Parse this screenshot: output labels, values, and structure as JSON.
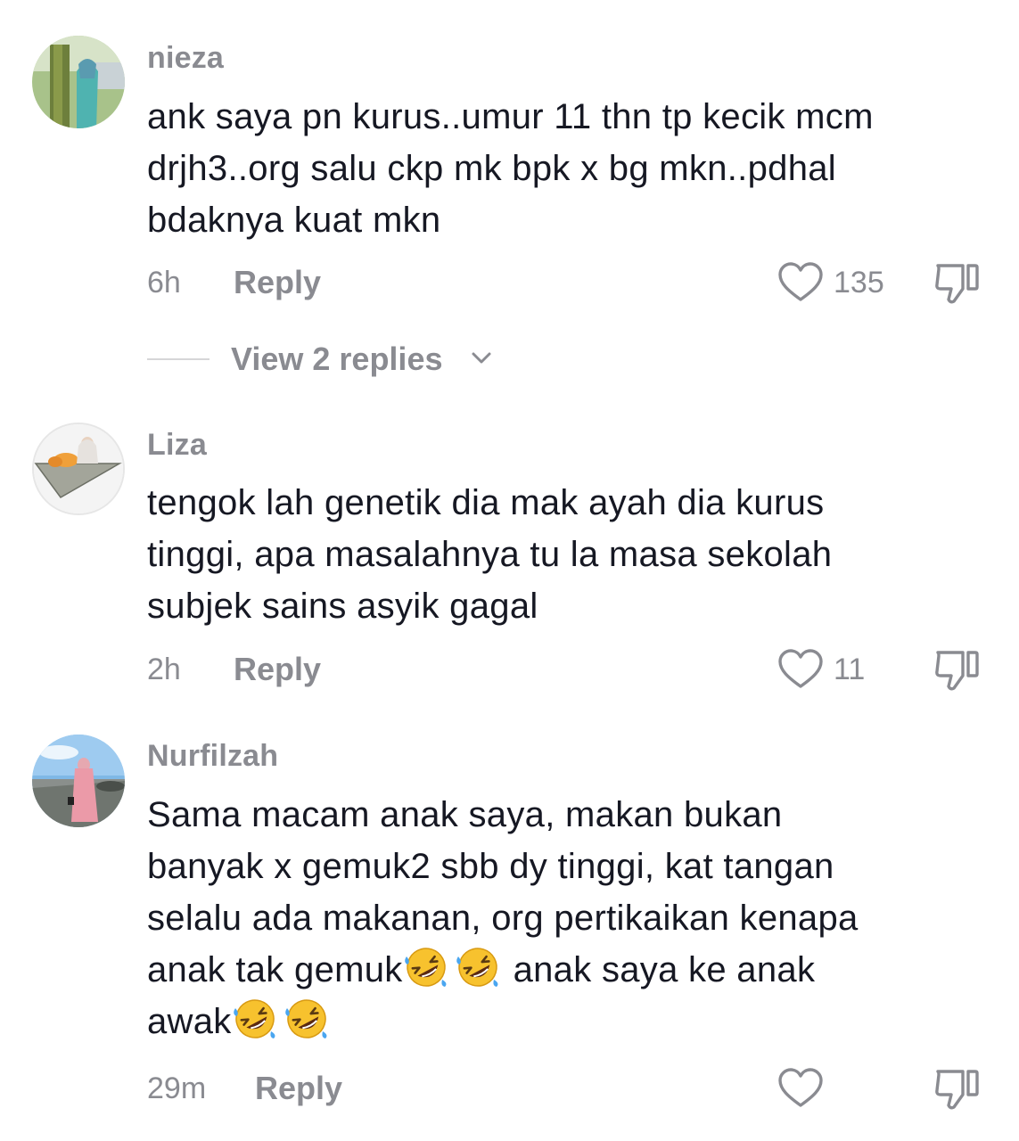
{
  "comments": [
    {
      "username": "nieza",
      "text_lines": [
        "ank saya pn kurus..umur 11 thn tp kecik mcm",
        "drjh3..org salu ckp mk bpk x bg mkn..pdhal",
        "bdaknya kuat mkn"
      ],
      "time": "6h",
      "reply_label": "Reply",
      "likes": "135",
      "view_replies": "View 2 replies"
    },
    {
      "username": "Liza",
      "text_lines": [
        "tengok lah genetik dia mak ayah dia kurus",
        "tinggi, apa masalahnya tu la masa sekolah",
        "subjek sains asyik gagal"
      ],
      "time": "2h",
      "reply_label": "Reply",
      "likes": "11"
    },
    {
      "username": "Nurfilzah",
      "text_lines": [
        "Sama macam anak saya, makan bukan",
        "banyak x gemuk2 sbb dy tinggi, kat tangan",
        "selalu ada makanan, org pertikaikan kenapa"
      ],
      "text_line4_a": "anak tak gemuk",
      "text_line4_b": "anak saya ke anak",
      "text_line5": "awak",
      "time": "29m",
      "reply_label": "Reply",
      "likes": ""
    }
  ],
  "icons": {
    "like": "heart-outline-icon",
    "dislike": "thumbs-down-icon",
    "expand": "chevron-down-icon",
    "emoji": "rolling-on-floor-laughing-emoji"
  },
  "colors": {
    "text": "#161823",
    "muted": "#8a8b91",
    "emoji_face": "#f7c22e"
  }
}
